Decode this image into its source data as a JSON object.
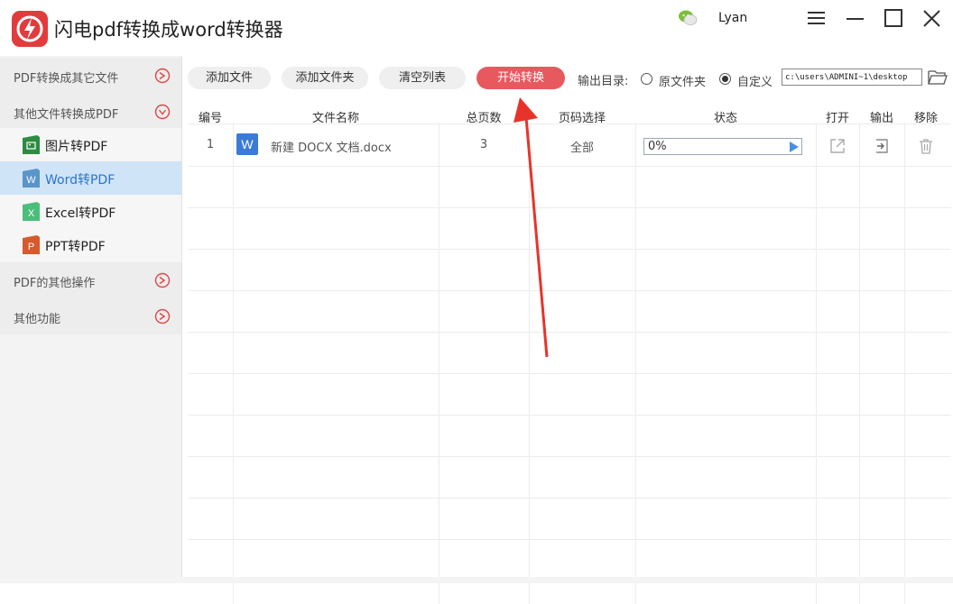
{
  "window": {
    "title": "闪电pdf转换成word转换器",
    "user": "Lyan"
  },
  "sidebar": {
    "categories": [
      {
        "label": "PDF转换成其它文件",
        "state": "collapsed"
      },
      {
        "label": "其他文件转换成PDF",
        "state": "expanded"
      },
      {
        "label": "PDF的其他操作",
        "state": "collapsed"
      },
      {
        "label": "其他功能",
        "state": "collapsed"
      }
    ],
    "subitems": [
      {
        "label": "图片转PDF",
        "icon": "image-file-icon",
        "badge": ""
      },
      {
        "label": "Word转PDF",
        "icon": "word-file-icon",
        "badge": "W",
        "active": true
      },
      {
        "label": "Excel转PDF",
        "icon": "excel-file-icon",
        "badge": "X"
      },
      {
        "label": "PPT转PDF",
        "icon": "ppt-file-icon",
        "badge": "P"
      }
    ]
  },
  "toolbar": {
    "add_file": "添加文件",
    "add_folder": "添加文件夹",
    "clear_list": "清空列表",
    "start_convert": "开始转换",
    "output_dir_label": "输出目录:",
    "option_original": "原文件夹",
    "option_custom": "自定义",
    "selected_option": "custom",
    "path_value": "c:\\users\\ADMINI~1\\desktop"
  },
  "table": {
    "headers": [
      "编号",
      "文件名称",
      "总页数",
      "页码选择",
      "状态",
      "打开",
      "输出",
      "移除"
    ],
    "rows": [
      {
        "index": "1",
        "file_badge": "W",
        "name": "新建 DOCX 文档.docx",
        "pages": "3",
        "page_select": "全部",
        "progress": "0%"
      }
    ]
  },
  "colors": {
    "accent": "#e8595f",
    "active_item_bg": "#cfe4f7",
    "active_item_text": "#2b74c8",
    "word_blue": "#3a7bd5",
    "arrow": "#e8332b"
  }
}
